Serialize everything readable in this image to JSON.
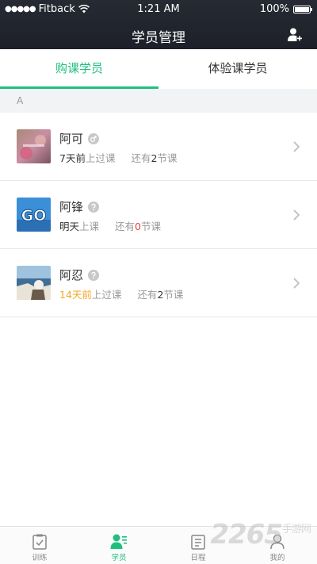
{
  "status_bar": {
    "carrier": "Fitback",
    "signal_dots": "●●●●●",
    "time": "1:21 AM",
    "battery": "100%"
  },
  "header": {
    "title": "学员管理",
    "add_icon": "add-user-icon"
  },
  "tabs": [
    {
      "label": "购课学员",
      "active": true
    },
    {
      "label": "体验课学员",
      "active": false
    }
  ],
  "section": {
    "letter": "A"
  },
  "students": [
    {
      "name": "阿可",
      "gender_icon": "male-icon",
      "last_prefix": "7天前",
      "last_suffix": "上过课",
      "remain_prefix": "还有",
      "remain_count": "2",
      "remain_suffix": "节课"
    },
    {
      "name": "阿锋",
      "gender_icon": "unknown-gender-icon",
      "last_prefix": "明天",
      "last_suffix": "上课",
      "remain_prefix": "还有",
      "remain_count": "0",
      "remain_suffix": "节课"
    },
    {
      "name": "阿忍",
      "gender_icon": "unknown-gender-icon",
      "last_prefix": "14天前",
      "last_suffix": "上过课",
      "remain_prefix": "还有",
      "remain_count": "2",
      "remain_suffix": "节课"
    }
  ],
  "tabbar": [
    {
      "label": "训练",
      "icon": "clipboard-icon",
      "active": false
    },
    {
      "label": "学员",
      "icon": "students-icon",
      "active": true
    },
    {
      "label": "日程",
      "icon": "schedule-icon",
      "active": false
    },
    {
      "label": "我的",
      "icon": "profile-icon",
      "active": false
    }
  ],
  "watermark": {
    "text": "2265",
    "sub": "手游网"
  },
  "colors": {
    "accent": "#1fbf7f",
    "header": "#22262e",
    "orange": "#f5a623",
    "red": "#e64340"
  }
}
